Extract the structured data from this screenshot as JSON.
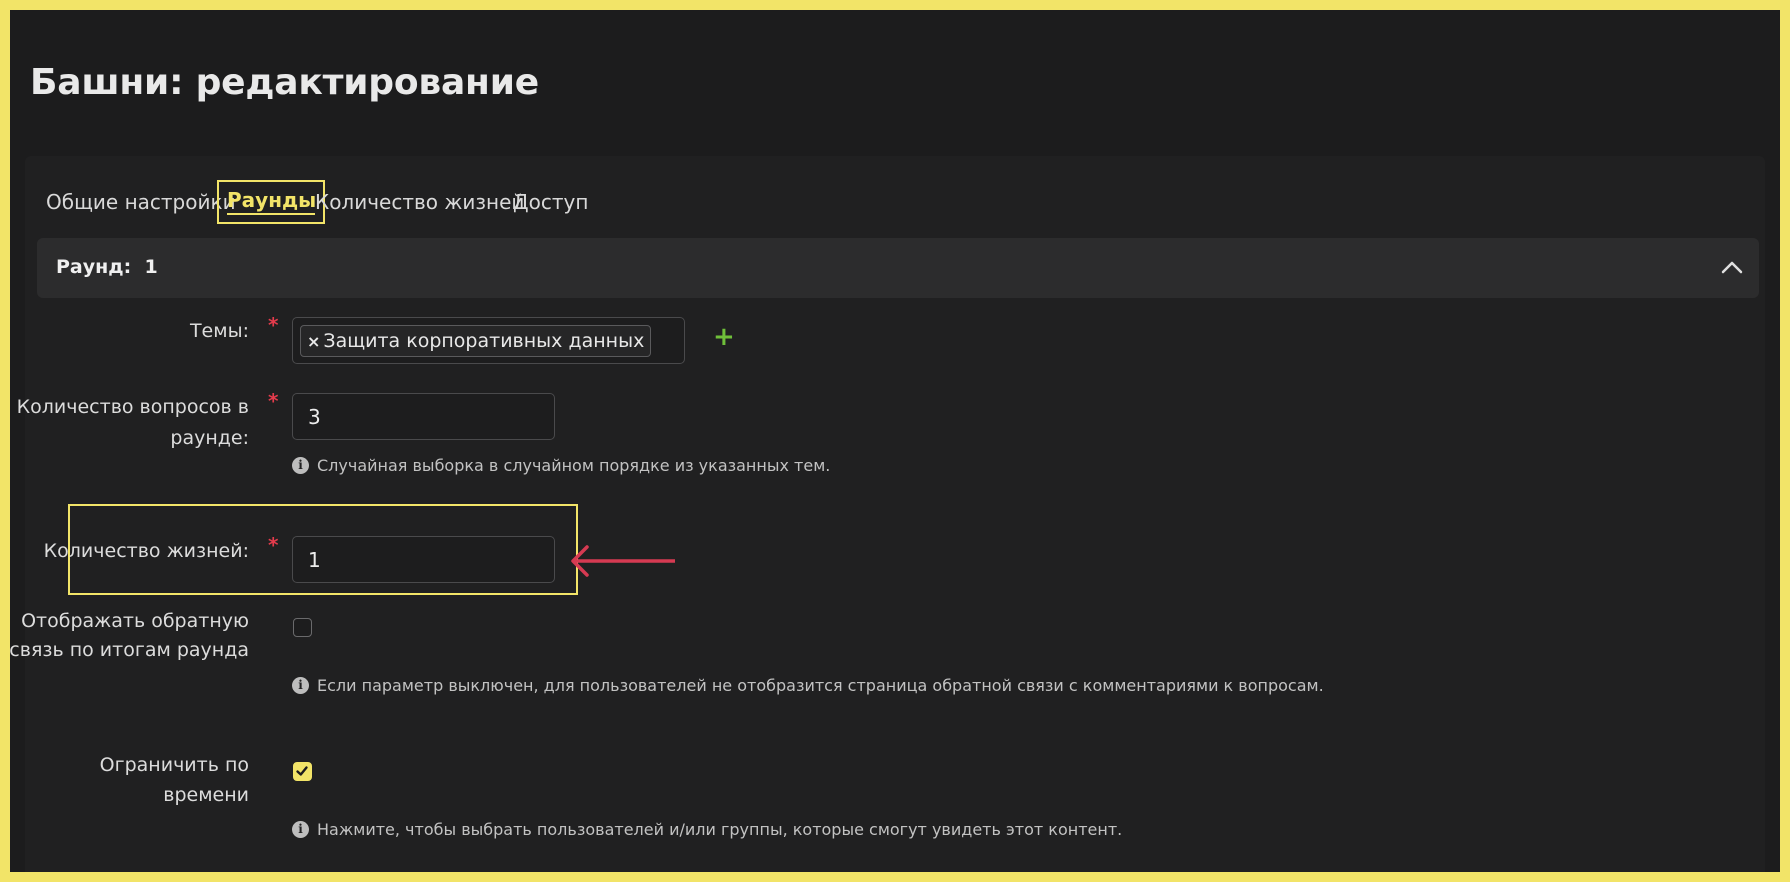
{
  "page_title": "Башни: редактирование",
  "tabs": [
    {
      "label": "Общие настройки",
      "active": false
    },
    {
      "label": "Раунды",
      "active": true
    },
    {
      "label": "Количество жизней",
      "active": false
    },
    {
      "label": "Доступ",
      "active": false
    }
  ],
  "round": {
    "label": "Раунд:",
    "number": "1"
  },
  "form": {
    "themes": {
      "label": "Темы:",
      "required": "*",
      "tags": [
        "Защита корпоративных данных"
      ],
      "remove_glyph": "×",
      "add_glyph": "+"
    },
    "questions_count": {
      "label_line1": "Количество вопросов в",
      "label_line2": "раунде:",
      "required": "*",
      "value": "3",
      "hint": "Случайная выборка в случайном порядке из указанных тем."
    },
    "lives_count": {
      "label": "Количество жизней:",
      "required": "*",
      "value": "1"
    },
    "show_feedback": {
      "label_line1": "Отображать обратную",
      "label_line2": "связь по итогам раунда",
      "checked": false,
      "hint": "Если параметр выключен, для пользователей не отобразится страница обратной связи с комментариями к вопросам."
    },
    "time_limit": {
      "label_line1": "Ограничить по",
      "label_line2": "времени",
      "checked": true,
      "hint": "Нажмите, чтобы выбрать пользователей и/или группы, которые смогут увидеть этот контент."
    },
    "info_glyph": "i"
  },
  "colors": {
    "accent": "#f2e468",
    "required": "#e53b4c",
    "add": "#6fbf3a",
    "arrow": "#d63a52"
  }
}
